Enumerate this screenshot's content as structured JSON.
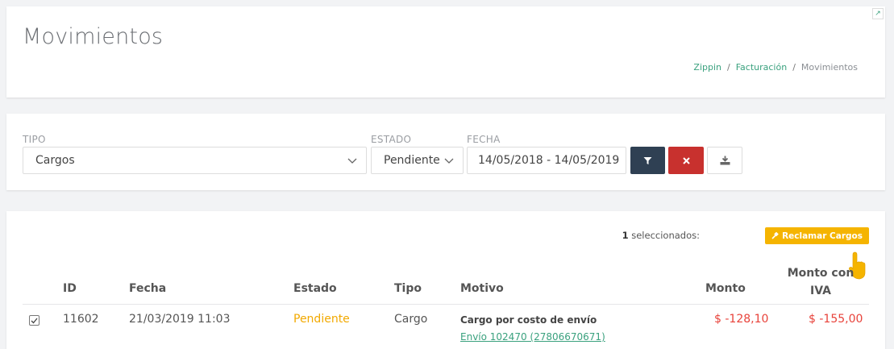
{
  "header": {
    "title": "Movimientos",
    "breadcrumb": [
      "Zippin",
      "Facturación",
      "Movimientos"
    ],
    "corner_icon": "expand-icon"
  },
  "filters": {
    "tipo": {
      "label": "TIPO",
      "value": "Cargos"
    },
    "estado": {
      "label": "ESTADO",
      "value": "Pendiente"
    },
    "fecha": {
      "label": "FECHA",
      "value": "14/05/2018 - 14/05/2019"
    },
    "buttons": [
      "filter-icon",
      "close-icon",
      "download-icon"
    ],
    "colors": {
      "filter": "#2f4053",
      "clear": "#c8312e"
    }
  },
  "table": {
    "selected_count": "1",
    "selected_label": "seleccionados:",
    "claim_label": "Reclamar Cargos",
    "claim_color": "#f5b400",
    "columns": {
      "id": "ID",
      "fecha": "Fecha",
      "estado": "Estado",
      "tipo": "Tipo",
      "motivo": "Motivo",
      "monto": "Monto",
      "monto_iva_1": "Monto con",
      "monto_iva_2": "IVA"
    },
    "rows": [
      {
        "checked": true,
        "id": "11602",
        "fecha": "21/03/2019 11:03",
        "estado": "Pendiente",
        "tipo": "Cargo",
        "motivo": "Cargo por costo de envío",
        "motivo_link": "Envío 102470 (27806670671)",
        "monto": "$ -128,10",
        "monto_iva": "$ -155,00"
      }
    ]
  }
}
